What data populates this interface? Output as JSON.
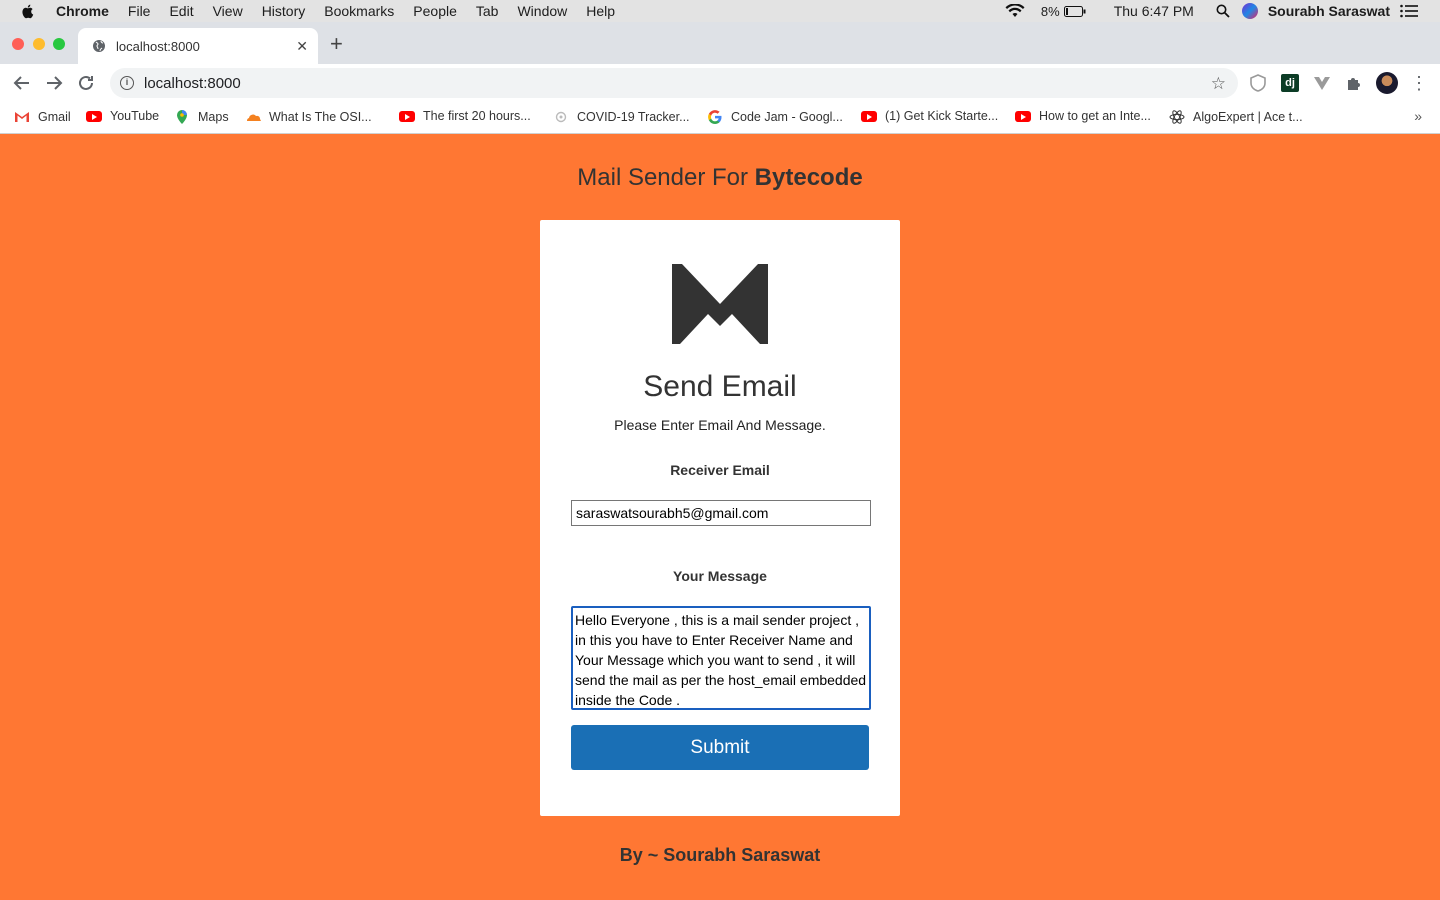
{
  "menubar": {
    "app": "Chrome",
    "items": [
      "File",
      "Edit",
      "View",
      "History",
      "Bookmarks",
      "People",
      "Tab",
      "Window",
      "Help"
    ],
    "battery": "8%",
    "clock": "Thu 6:47 PM",
    "user": "Sourabh Saraswat"
  },
  "tab": {
    "title": "localhost:8000"
  },
  "address": {
    "url": "localhost:8000"
  },
  "bookmarks": [
    {
      "label": "Gmail",
      "icon": "gmail-icon"
    },
    {
      "label": "YouTube",
      "icon": "youtube-icon"
    },
    {
      "label": "Maps",
      "icon": "maps-icon"
    },
    {
      "label": "What Is The OSI...",
      "icon": "cloudflare-icon"
    },
    {
      "label": "The first 20 hours...",
      "icon": "youtube-icon"
    },
    {
      "label": "COVID-19 Tracker...",
      "icon": "covid-icon"
    },
    {
      "label": "Code Jam - Googl...",
      "icon": "google-icon"
    },
    {
      "label": "(1) Get Kick Starte...",
      "icon": "youtube-icon"
    },
    {
      "label": "How to get an Inte...",
      "icon": "youtube-icon"
    },
    {
      "label": "AlgoExpert | Ace t...",
      "icon": "algoexpert-icon"
    }
  ],
  "page": {
    "title_prefix": "Mail Sender For ",
    "title_bold": "Bytecode",
    "card_title": "Send Email",
    "card_subtitle": "Please Enter Email And Message.",
    "email_label": "Receiver Email",
    "email_value": "saraswatsourabh5@gmail.com",
    "message_label": "Your Message",
    "message_value": "Hello Everyone , this is a mail sender project , in this you have to Enter Receiver Name and Your Message which you want to send , it will send the mail as per the host_email embedded inside the Code .",
    "submit_label": "Submit",
    "footer": "By ~ Sourabh Saraswat"
  },
  "colors": {
    "background": "#ff7733",
    "button": "#1a6fb5",
    "text": "#333333"
  }
}
